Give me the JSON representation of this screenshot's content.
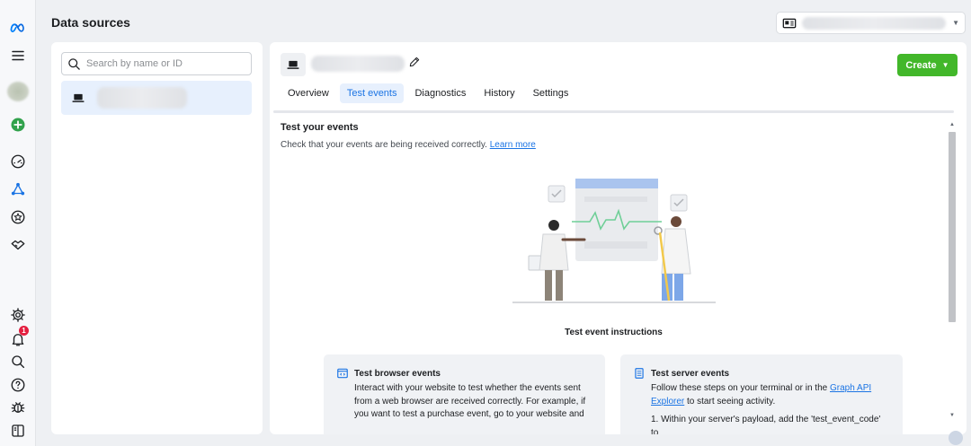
{
  "header": {
    "title": "Data sources"
  },
  "search": {
    "placeholder": "Search by name or ID"
  },
  "toolbar": {
    "create_label": "Create"
  },
  "tabs": [
    {
      "label": "Overview",
      "active": false
    },
    {
      "label": "Test events",
      "active": true
    },
    {
      "label": "Diagnostics",
      "active": false
    },
    {
      "label": "History",
      "active": false
    },
    {
      "label": "Settings",
      "active": false
    }
  ],
  "test_events": {
    "title": "Test your events",
    "description": "Check that your events are being received correctly.",
    "learn_more": "Learn more",
    "instructions_label": "Test event instructions"
  },
  "cards": {
    "browser": {
      "title": "Test browser events",
      "body": "Interact with your website to test whether the events sent from a web browser are received correctly. For example, if you want to test a purchase event, go to your website and"
    },
    "server": {
      "title": "Test server events",
      "body_before": "Follow these steps on your terminal or in the",
      "link": "Graph API Explorer",
      "body_after": "to start seeing activity.",
      "step1": "1. Within your server's payload, add the 'test_event_code' to"
    }
  },
  "notifications": {
    "count": "1"
  },
  "colors": {
    "primary": "#1b74e4",
    "create_green": "#42b72a",
    "active_bg": "#e7f0fd",
    "badge_red": "#e41e3f"
  },
  "icons": [
    "meta-logo-icon",
    "menu-icon",
    "avatar",
    "add-icon",
    "dashboard-icon",
    "events-manager-icon",
    "star-icon",
    "partner-icon",
    "settings-icon",
    "bell-icon",
    "search-icon",
    "help-icon",
    "bug-icon",
    "panel-icon",
    "laptop-icon",
    "pencil-icon",
    "code-icon",
    "server-icon",
    "globe-icon"
  ]
}
